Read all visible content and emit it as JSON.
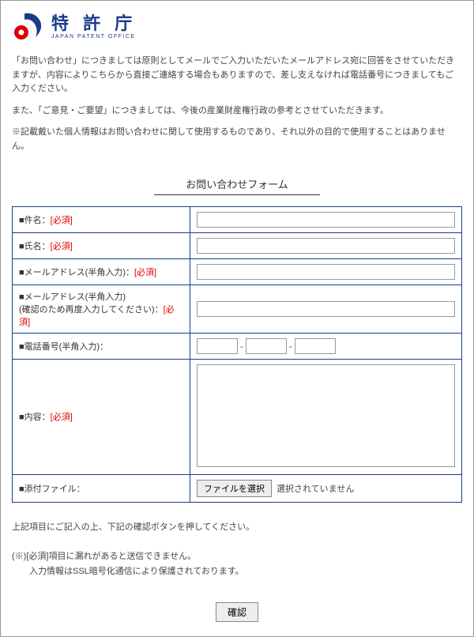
{
  "logo": {
    "title": "特 許 庁",
    "subtitle": "JAPAN PATENT OFFICE"
  },
  "intro": {
    "p1": "「お問い合わせ」につきましては原則としてメールでご入力いただいたメールアドレス宛に回答をさせていただきますが、内容によりこちらから直接ご連絡する場合もありますので、差し支えなければ電話番号につきましてもご入力ください。",
    "p2": "また、「ご意見・ご要望」につきましては、今後の産業財産権行政の参考とさせていただきます。",
    "p3": "※記載戴いた個人情報はお問い合わせに関して使用するものであり、それ以外の目的で使用することはありません。"
  },
  "form": {
    "title": "お問い合わせフォーム",
    "required_label": "[必須]",
    "bullet": "■ ",
    "fields": {
      "subject": "件名：",
      "name": "氏名：",
      "email": "メールアドレス(半角入力)：",
      "email_confirm_line1": "メールアドレス(半角入力)",
      "email_confirm_line2": "(確認のため再度入力してください)：",
      "phone": "電話番号(半角入力)：",
      "content": "内容：",
      "attachment": "添付ファイル："
    },
    "file_button": "ファイルを選択",
    "file_status": "選択されていません",
    "tel_sep": "-"
  },
  "notes": {
    "line1": "上記項目にご記入の上、下記の確認ボタンを押してください。",
    "line2": "(※)[必須]項目に漏れがあると送信できません。",
    "line3": "　　入力情報はSSL暗号化通信により保護されております。"
  },
  "submit": {
    "label": "確認"
  }
}
